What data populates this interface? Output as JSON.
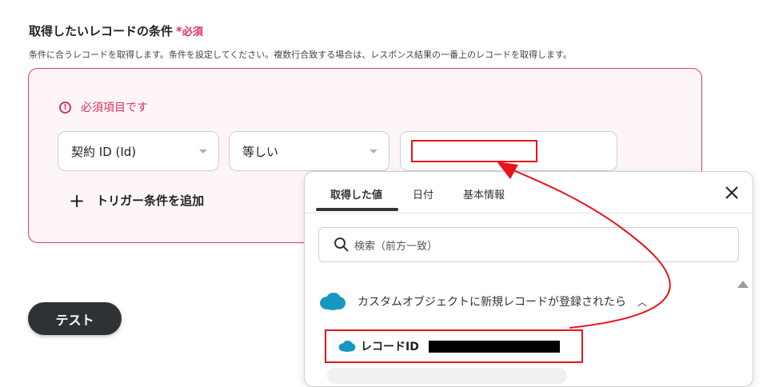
{
  "section": {
    "title": "取得したいレコードの条件",
    "required_mark": "*",
    "required_label": "必須",
    "description": "条件に合うレコードを取得します。条件を設定してください。複数行合致する場合は、レスポンス結果の一番上のレコードを取得します。"
  },
  "condition": {
    "error_message": "必須項目です",
    "field_select": "契約 ID (Id)",
    "operator_select": "等しい",
    "value_input": "",
    "add_trigger_label": "トリガー条件を追加"
  },
  "test_button_label": "テスト",
  "popup": {
    "tabs": [
      {
        "label": "取得した値"
      },
      {
        "label": "日付"
      },
      {
        "label": "基本情報"
      }
    ],
    "search_placeholder": "検索（前方一致）",
    "trigger_group_label": "カスタムオブジェクトに新規レコードが登録されたら",
    "field_item_label": "レコードID"
  },
  "colors": {
    "required": "#e0325b",
    "error_border": "#d63e73",
    "annotation_red": "#e8141b",
    "salesforce_blue": "#1798c1",
    "test_button_bg": "#2f3235"
  }
}
